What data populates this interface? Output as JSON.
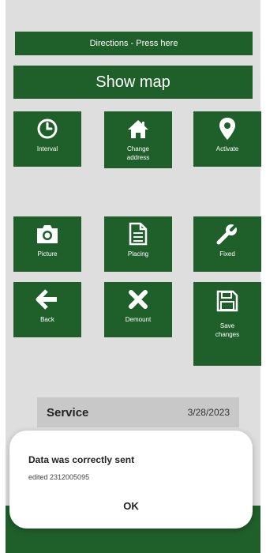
{
  "header": {
    "directions_label": "Directions - Press here",
    "showmap_label": "Show map"
  },
  "tiles": [
    {
      "label": "Interval",
      "icon": "clock-icon"
    },
    {
      "label": "Change address",
      "icon": "home-icon"
    },
    {
      "label": "Activate",
      "icon": "map-pin-icon"
    },
    {
      "label": "Picture",
      "icon": "camera-icon"
    },
    {
      "label": "Placing",
      "icon": "document-icon"
    },
    {
      "label": "Fixed",
      "icon": "wrench-icon"
    },
    {
      "label": "Back",
      "icon": "arrow-left-icon"
    },
    {
      "label": "Demount",
      "icon": "x-icon"
    },
    {
      "label": "Save changes",
      "icon": "save-icon"
    }
  ],
  "service": {
    "name": "Service",
    "date": "3/28/2023"
  },
  "dialog": {
    "title": "Data was correctly sent",
    "message": "edited 2312005095",
    "ok_label": "OK"
  },
  "colors": {
    "primary_green": "#1f5f2a",
    "background": "#dedede"
  }
}
